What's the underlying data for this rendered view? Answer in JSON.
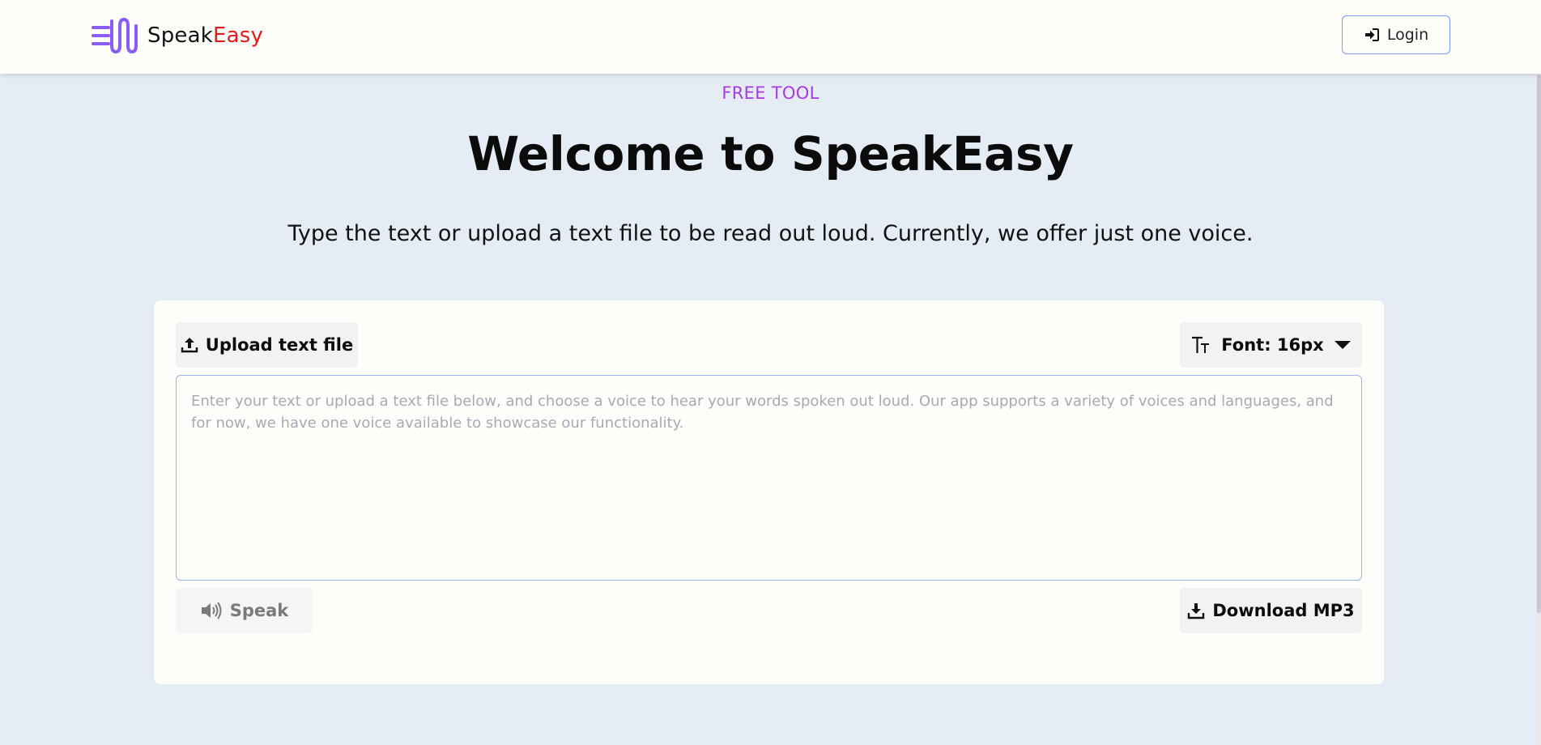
{
  "navbar": {
    "brand_part1": "Speak",
    "brand_part2": "Easy",
    "login_label": "Login"
  },
  "hero": {
    "tag": "FREE TOOL",
    "title": "Welcome to SpeakEasy",
    "subtitle": "Type the text or upload a text file to be read out loud. Currently, we offer just one voice."
  },
  "editor": {
    "upload_label": "Upload text file",
    "font_label": "Font: 16px",
    "textarea_value": "",
    "textarea_placeholder": "Enter your text or upload a text file below, and choose a voice to hear your words spoken out loud. Our app supports a variety of voices and languages, and for now, we have one voice available to showcase our functionality.",
    "speak_label": "Speak",
    "download_label": "Download MP3"
  },
  "icons": {
    "logo": "sound-wave-logo-icon",
    "login": "sign-in-icon",
    "upload": "upload-icon",
    "font": "text-height-icon",
    "dropdown": "caret-down-icon",
    "speak": "volume-icon",
    "download": "download-icon"
  },
  "colors": {
    "background": "#e6ecf4",
    "surface": "#fdfdfa",
    "accent_purple": "#a53be3",
    "brand_red": "#e31b1b",
    "border_blue": "#7d9af0",
    "logo_purple": "#8b5cf6"
  }
}
